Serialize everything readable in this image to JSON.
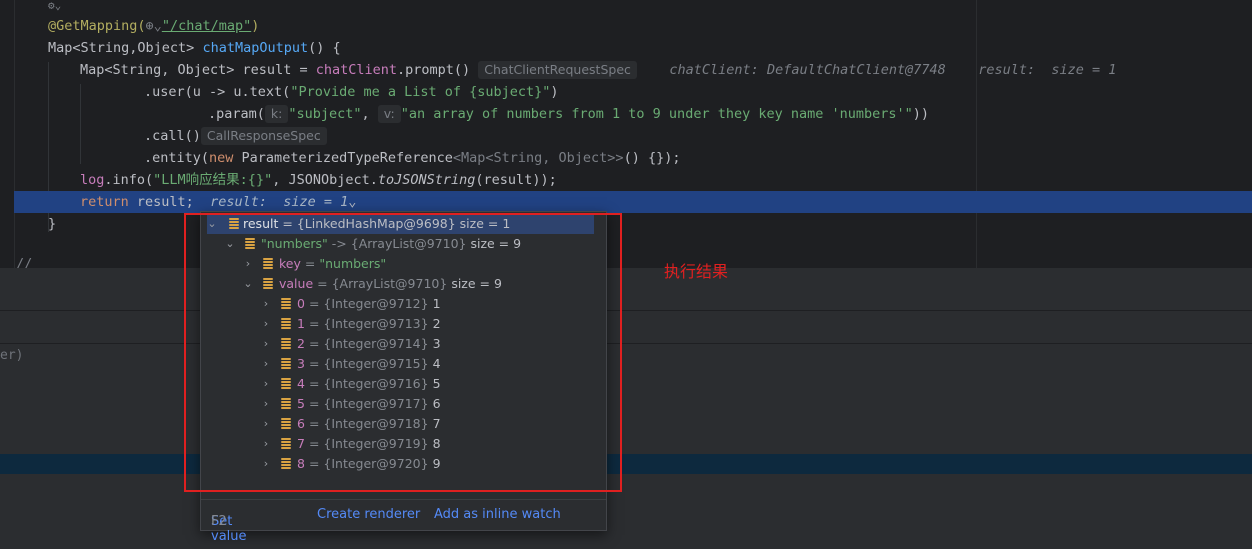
{
  "code": {
    "marker": "⚙⌄",
    "l1_annotation": "@GetMapping(",
    "l1_globe": "⊕⌄",
    "l1_path": "\"/chat/map\"",
    "l1_close": ")",
    "l2_type": "Map<String,Object> ",
    "l2_method": "chatMapOutput",
    "l2_rest": "() {",
    "l3_type": "Map<String, Object> result = ",
    "l3_client": "chatClient",
    "l3_call": ".prompt()",
    "l3_hint": "ChatClientRequestSpec",
    "l3_dbg1": "chatClient: DefaultChatClient@7748",
    "l3_dbg2": "result:  size = 1",
    "l4_a": ".user(u -> u.text(",
    "l4_str": "\"Provide me a List of {subject}\"",
    "l4_b": ")",
    "l5_a": ".param(",
    "l5_k": "k:",
    "l5_str1": "\"subject\"",
    "l5_comma": ", ",
    "l5_v": "v:",
    "l5_str2": "\"an array of numbers from 1 to 9 under they key name 'numbers'\"",
    "l5_b": "))",
    "l6_a": ".call()",
    "l6_hint": "CallResponseSpec",
    "l7_a": ".entity(",
    "l7_kw": "new",
    "l7_b": " ParameterizedTypeReference",
    "l7_generic": "<Map<String, Object>>",
    "l7_c": "() {});",
    "l8_log": "log",
    "l8_a": ".info(",
    "l8_str": "\"LLM响应结果:{}\"",
    "l8_b": ", JSONObject.",
    "l8_method": "toJSONString",
    "l8_c": "(result));",
    "l9_kw": "return",
    "l9_a": " result;",
    "l9_dbg": "result:  size = 1",
    "l9_chev": "⌄",
    "l10": "}",
    "l11": "//"
  },
  "bottom_panel": {
    "fragment": "er)"
  },
  "popup": {
    "rows": [
      {
        "name": "result",
        "type": "= {LinkedHashMap@9698}",
        "value": "size = 1",
        "expanded": true
      },
      {
        "name": "\"numbers\"",
        "type": "-> {ArrayList@9710}",
        "value": "size = 9",
        "expanded": true
      },
      {
        "name": "key",
        "type": "=",
        "value": "\"numbers\"",
        "expanded": false
      },
      {
        "name": "value",
        "type": "= {ArrayList@9710}",
        "value": "size = 9",
        "expanded": true
      },
      {
        "name": "0",
        "type": "= {Integer@9712}",
        "value": "1"
      },
      {
        "name": "1",
        "type": "= {Integer@9713}",
        "value": "2"
      },
      {
        "name": "2",
        "type": "= {Integer@9714}",
        "value": "3"
      },
      {
        "name": "3",
        "type": "= {Integer@9715}",
        "value": "4"
      },
      {
        "name": "4",
        "type": "= {Integer@9716}",
        "value": "5"
      },
      {
        "name": "5",
        "type": "= {Integer@9717}",
        "value": "6"
      },
      {
        "name": "6",
        "type": "= {Integer@9718}",
        "value": "7"
      },
      {
        "name": "7",
        "type": "= {Integer@9719}",
        "value": "8"
      },
      {
        "name": "8",
        "type": "= {Integer@9720}",
        "value": "9"
      }
    ],
    "footer": {
      "set_value": "Set value",
      "set_value_key": "F2",
      "create_renderer": "Create renderer",
      "add_watch": "Add as inline watch"
    }
  },
  "annotation": {
    "label": "执行结果",
    "color": "#e02020"
  },
  "icons": {
    "expand": "chevron-right-icon",
    "collapse": "chevron-down-icon",
    "object": "object-field-icon"
  }
}
